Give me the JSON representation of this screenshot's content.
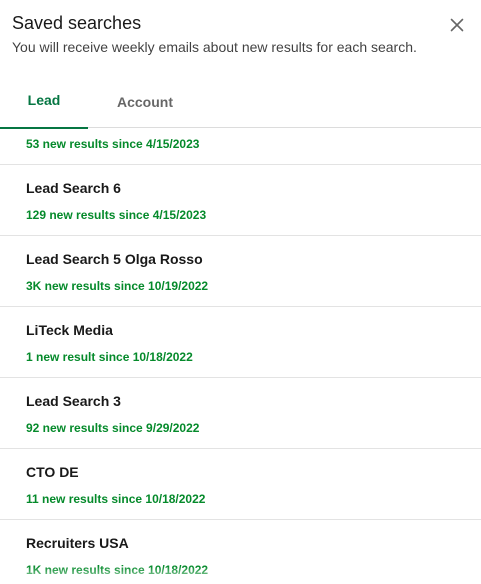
{
  "header": {
    "title": "Saved searches",
    "subtitle": "You will receive weekly emails about new results for each search.",
    "close_icon": "close-icon"
  },
  "tabs": [
    {
      "label": "Lead",
      "active": true
    },
    {
      "label": "Account",
      "active": false
    }
  ],
  "colors": {
    "accent_green": "#057642",
    "results_green": "#058a2b"
  },
  "searches": [
    {
      "name": "",
      "results": "53 new results since 4/15/2023"
    },
    {
      "name": "Lead Search 6",
      "results": "129 new results since 4/15/2023"
    },
    {
      "name": "Lead Search 5 Olga Rosso",
      "results": "3K new results since 10/19/2022"
    },
    {
      "name": "LiTeck Media",
      "results": "1 new result since 10/18/2022"
    },
    {
      "name": "Lead Search 3",
      "results": "92 new results since 9/29/2022"
    },
    {
      "name": "CTO DE",
      "results": "11 new results since 10/18/2022"
    },
    {
      "name": "Recruiters USA",
      "results": "1K new results since 10/18/2022"
    }
  ]
}
